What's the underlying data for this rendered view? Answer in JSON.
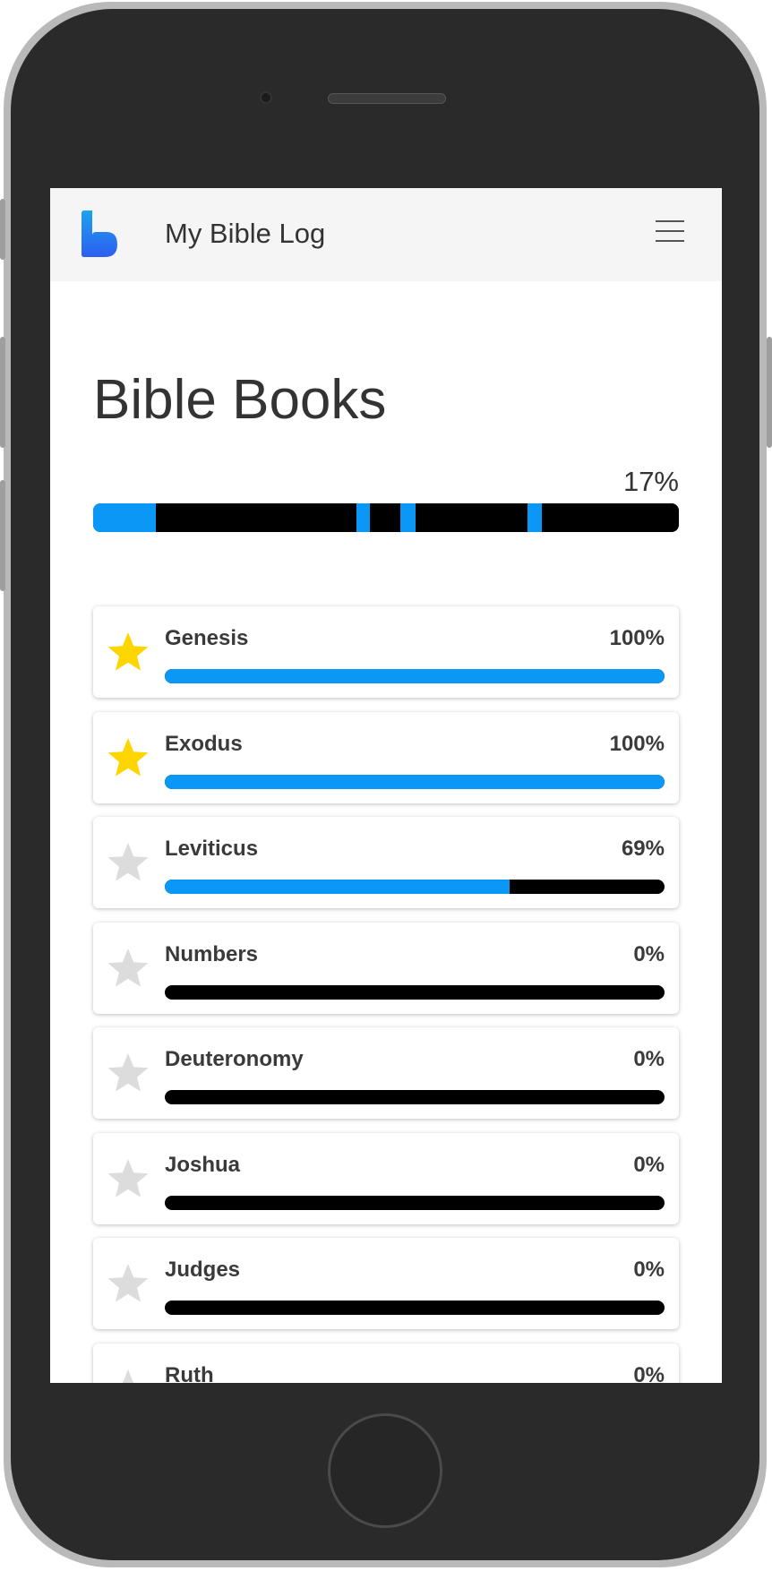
{
  "app": {
    "title": "My Bible Log"
  },
  "page": {
    "title": "Bible Books"
  },
  "overall": {
    "percent_label": "17%",
    "read_segments": [
      {
        "start": 0.0,
        "end": 0.107
      },
      {
        "start": 0.449,
        "end": 0.472
      },
      {
        "start": 0.525,
        "end": 0.551
      },
      {
        "start": 0.741,
        "end": 0.766
      }
    ]
  },
  "books": [
    {
      "name": "Genesis",
      "percent_label": "100%",
      "progress": 1.0,
      "starred": true
    },
    {
      "name": "Exodus",
      "percent_label": "100%",
      "progress": 1.0,
      "starred": true
    },
    {
      "name": "Leviticus",
      "percent_label": "69%",
      "progress": 0.69,
      "starred": false
    },
    {
      "name": "Numbers",
      "percent_label": "0%",
      "progress": 0,
      "starred": false
    },
    {
      "name": "Deuteronomy",
      "percent_label": "0%",
      "progress": 0,
      "starred": false
    },
    {
      "name": "Joshua",
      "percent_label": "0%",
      "progress": 0,
      "starred": false
    },
    {
      "name": "Judges",
      "percent_label": "0%",
      "progress": 0,
      "starred": false
    },
    {
      "name": "Ruth",
      "percent_label": "0%",
      "progress": 0,
      "starred": false
    }
  ],
  "icons": {
    "logo": "bible-log-logo-icon",
    "menu": "hamburger-menu-icon",
    "star": "star-icon"
  },
  "colors": {
    "progress": "#0a97f5",
    "track": "#000000",
    "star_active": "#ffd500",
    "star_inactive": "#dcdcdc",
    "logo_top": "#1ba3f0",
    "logo_bottom": "#2e5ef0"
  }
}
